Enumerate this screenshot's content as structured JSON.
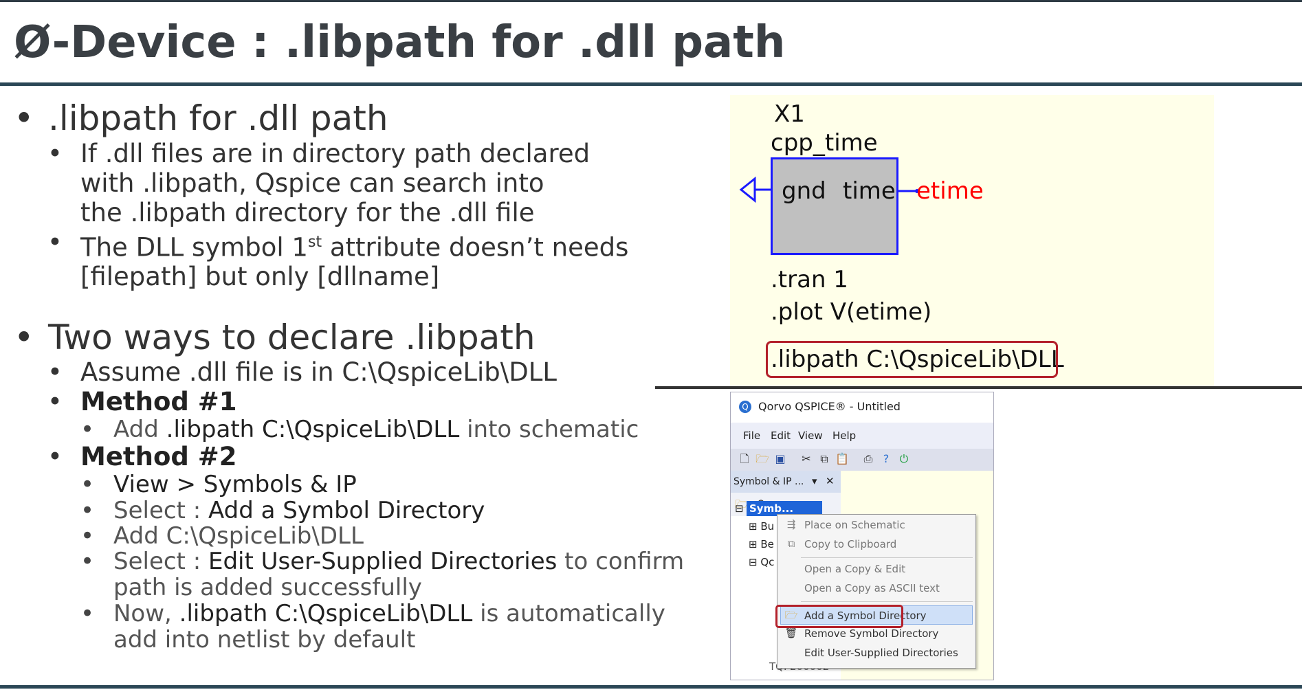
{
  "slide": {
    "title": "Ø-Device : .libpath for .dll path"
  },
  "bullets": {
    "b1": ".libpath for .dll path",
    "b1_sub1_line1": "If .dll files are in directory path declared",
    "b1_sub1_line2": "with .libpath, Qspice can search into",
    "b1_sub1_line3": "the .libpath directory for the .dll file",
    "b1_sub2_pre": "The DLL symbol 1",
    "b1_sub2_sup": "st",
    "b1_sub2_post": " attribute doesn’t needs",
    "b1_sub2_line2": "[filepath] but only [dllname]",
    "b2": "Two ways to declare .libpath",
    "b2_sub1": "Assume .dll file is in C:\\QspiceLib\\DLL",
    "method1": "Method #1",
    "m1_pre": "Add ",
    "m1_code": ".libpath C:\\QspiceLib\\DLL",
    "m1_post": " into schematic",
    "method2": "Method #2",
    "m2_1": "View > Symbols & IP",
    "m2_2_pre": "Select : ",
    "m2_2_strong": "Add a Symbol Directory",
    "m2_3": "Add C:\\QspiceLib\\DLL",
    "m2_4_pre": "Select : ",
    "m2_4_strong": "Edit User-Supplied Directories",
    "m2_4_post": " to confirm",
    "m2_4_line2": "path is added successfully",
    "m2_5_pre": "Now, ",
    "m2_5_strong": ".libpath C:\\QspiceLib\\DLL",
    "m2_5_post": " is automatically",
    "m2_5_line2": "add into netlist by default"
  },
  "schematic": {
    "instance": "X1",
    "model": "cpp_time",
    "pin_left": "gnd",
    "pin_right": "time",
    "net_label": "etime",
    "tran": ".tran 1",
    "plot": ".plot V(etime)",
    "libpath": ".libpath C:\\QspiceLib\\DLL",
    "colors": {
      "bg": "#ffffe9",
      "box": "#c0c0c0",
      "border": "#1a1aff",
      "net": "#ff0000"
    }
  },
  "qspice": {
    "window_title": "Qorvo QSPICE® - Untitled",
    "menu": [
      "File",
      "Edit",
      "View",
      "Help"
    ],
    "panel_title": "Symbol & IP ...",
    "tree_selected": "Symb...",
    "tree_items": [
      "Bu",
      "Be",
      "Qc"
    ],
    "tree_bottom": "TQP200002",
    "context_menu": [
      {
        "label": "Place on Schematic",
        "enabled": false,
        "icon": "place-icon"
      },
      {
        "label": "Copy to Clipboard",
        "enabled": false,
        "icon": "copy-icon"
      },
      {
        "label": "Open a Copy & Edit",
        "enabled": false,
        "icon": ""
      },
      {
        "label": "Open a Copy as ASCII text",
        "enabled": false,
        "icon": ""
      },
      {
        "label": "Add a Symbol Directory",
        "enabled": true,
        "icon": "folder-open-icon",
        "highlighted": true
      },
      {
        "label": "Remove Symbol Directory",
        "enabled": true,
        "icon": "trash-icon"
      },
      {
        "label": "Edit User-Supplied Directories",
        "enabled": true,
        "icon": ""
      }
    ]
  }
}
